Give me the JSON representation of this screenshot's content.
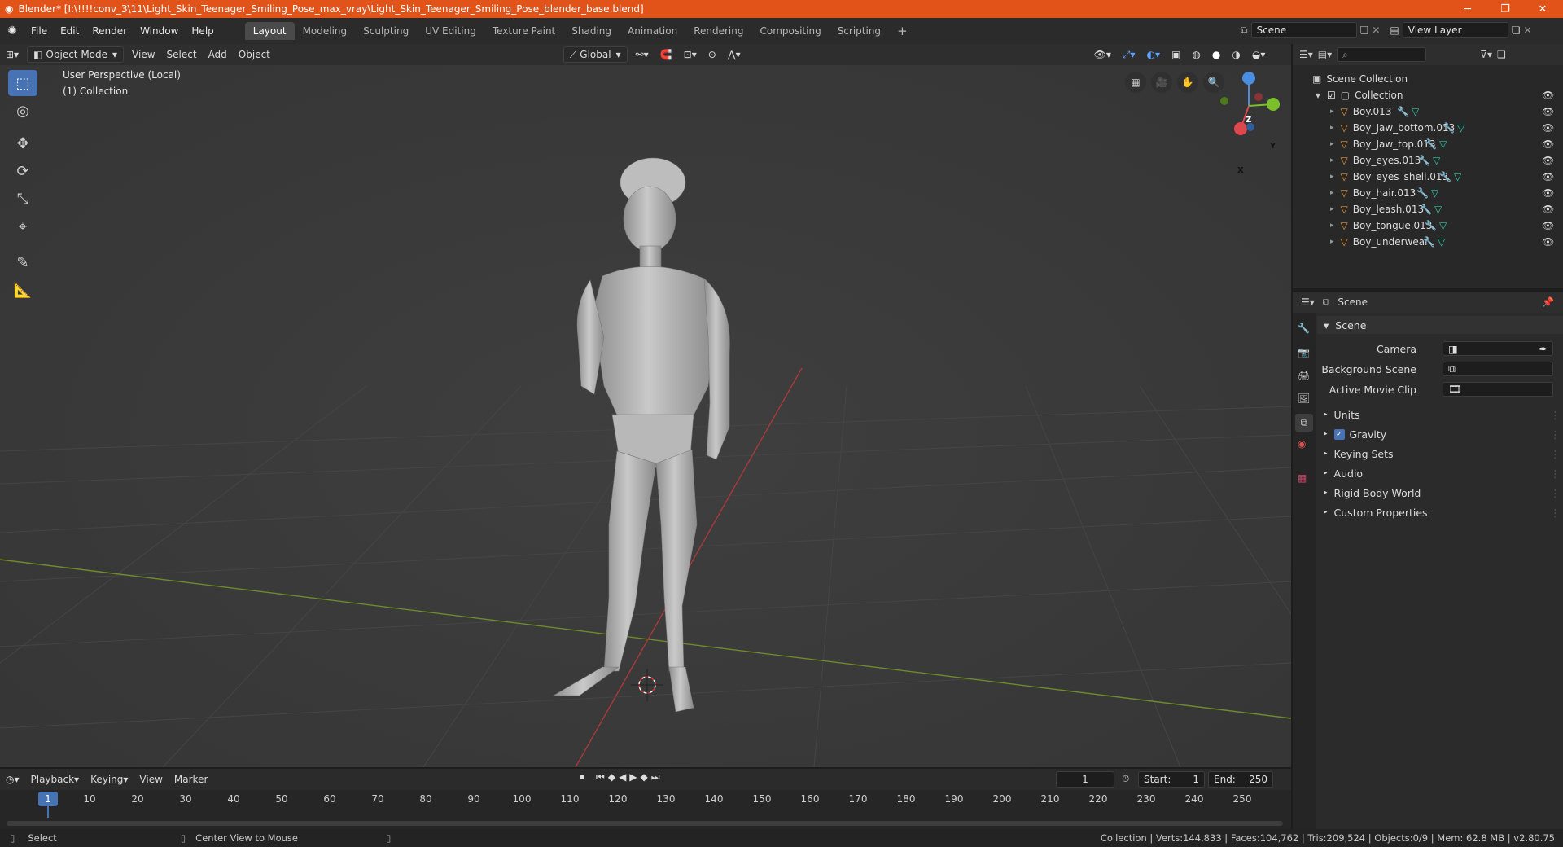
{
  "window": {
    "title": "Blender* [I:\\!!!!conv_3\\11\\Light_Skin_Teenager_Smiling_Pose_max_vray\\Light_Skin_Teenager_Smiling_Pose_blender_base.blend]",
    "minimize": "─",
    "restore": "❐",
    "close": "✕"
  },
  "menu": [
    "File",
    "Edit",
    "Render",
    "Window",
    "Help"
  ],
  "workspaces": [
    "Layout",
    "Modeling",
    "Sculpting",
    "UV Editing",
    "Texture Paint",
    "Shading",
    "Animation",
    "Rendering",
    "Compositing",
    "Scripting"
  ],
  "add_workspace": "+",
  "scene_field": "Scene",
  "view_layer_field": "View Layer",
  "viewport": {
    "mode": "Object Mode",
    "menus": [
      "View",
      "Select",
      "Add",
      "Object"
    ],
    "orientation": "Global",
    "overlay_line1": "User Perspective (Local)",
    "overlay_line2": "(1) Collection",
    "gizmo": {
      "z": "Z",
      "y": "Y",
      "x": "X"
    }
  },
  "outliner": {
    "root": "Scene Collection",
    "collection": "Collection",
    "items": [
      "Boy.013",
      "Boy_Jaw_bottom.013",
      "Boy_Jaw_top.013",
      "Boy_eyes.013",
      "Boy_eyes_shell.013",
      "Boy_hair.013",
      "Boy_leash.013",
      "Boy_tongue.013",
      "Boy_underwear"
    ]
  },
  "properties": {
    "context": "Scene",
    "panel": "Scene",
    "camera_label": "Camera",
    "background_label": "Background Scene",
    "movie_clip_label": "Active Movie Clip",
    "sections": [
      "Units",
      "Gravity",
      "Keying Sets",
      "Audio",
      "Rigid Body World",
      "Custom Properties"
    ]
  },
  "timeline": {
    "menus": [
      "Playback",
      "Keying",
      "View",
      "Marker"
    ],
    "current_frame": "1",
    "start_label": "Start:",
    "start": "1",
    "end_label": "End:",
    "end": "250",
    "ticks": [
      "10",
      "20",
      "30",
      "40",
      "50",
      "60",
      "70",
      "80",
      "90",
      "100",
      "110",
      "120",
      "130",
      "140",
      "150",
      "160",
      "170",
      "180",
      "190",
      "200",
      "210",
      "220",
      "230",
      "240",
      "250"
    ],
    "playhead": "1"
  },
  "status": {
    "left1": "Select",
    "left2": "Center View to Mouse",
    "right": "Collection | Verts:144,833 | Faces:104,762 | Tris:209,524 | Objects:0/9 | Mem: 62.8 MB | v2.80.75"
  },
  "colors": {
    "accent": "#4772b3",
    "titlebar": "#e2531a",
    "mesh_icon": "#e8913a",
    "modifier_icon": "#5ea1ff",
    "data_icon": "#29c9a5"
  }
}
